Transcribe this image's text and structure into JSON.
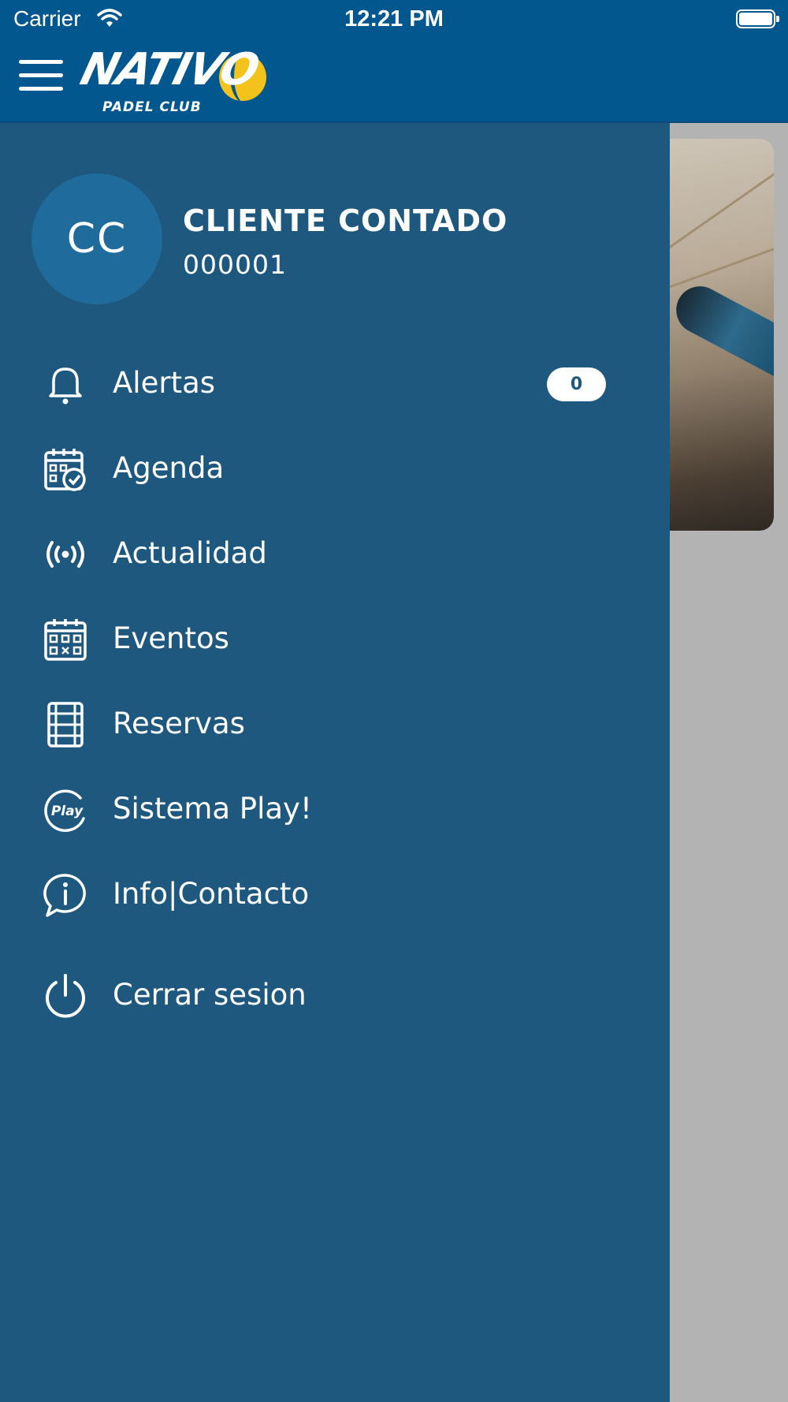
{
  "status_bar": {
    "carrier": "Carrier",
    "time": "12:21 PM"
  },
  "header": {
    "logo_main": "NATIVO",
    "logo_sub": "PADEL CLUB"
  },
  "user": {
    "initials": "CC",
    "name": "CLIENTE CONTADO",
    "code": "000001"
  },
  "menu": {
    "items": [
      {
        "label": "Alertas",
        "icon": "bell-icon",
        "badge": "0"
      },
      {
        "label": "Agenda",
        "icon": "calendar-check-icon"
      },
      {
        "label": "Actualidad",
        "icon": "broadcast-icon"
      },
      {
        "label": "Eventos",
        "icon": "calendar-grid-icon"
      },
      {
        "label": "Reservas",
        "icon": "court-icon"
      },
      {
        "label": "Sistema Play!",
        "icon": "play-badge-icon"
      },
      {
        "label": "Info|Contacto",
        "icon": "info-chat-icon"
      },
      {
        "label": "Cerrar sesion",
        "icon": "power-icon"
      }
    ]
  },
  "colors": {
    "nav_bar": "#02578f",
    "drawer": "#1e587f",
    "avatar": "#1f6c9c",
    "logo_accent": "#f3c31b"
  }
}
